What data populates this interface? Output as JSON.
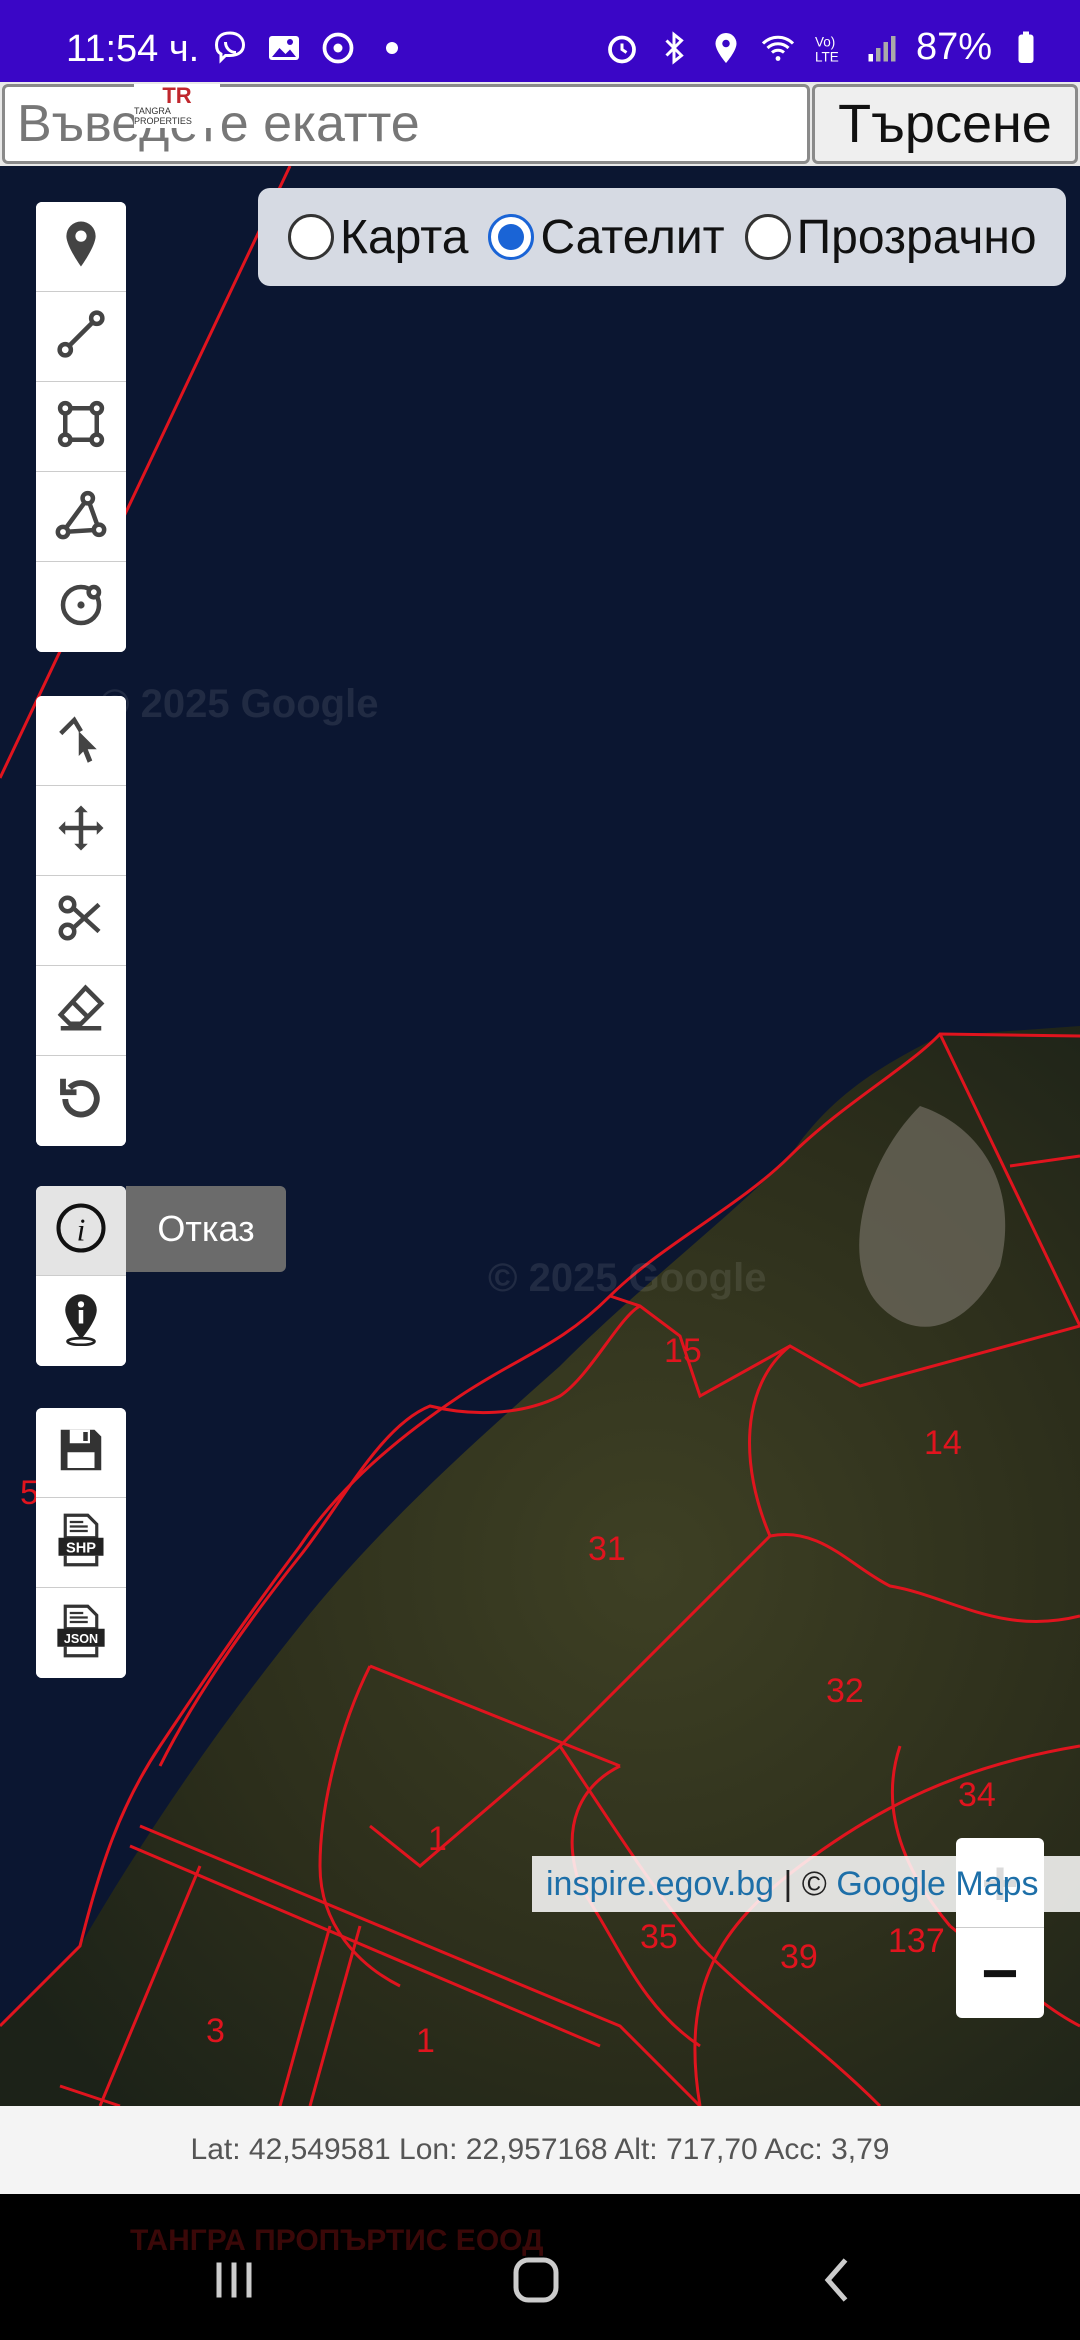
{
  "status_bar": {
    "time": "11:54 ч.",
    "battery": "87%",
    "colors": {
      "background": "#3a06c6"
    }
  },
  "search": {
    "placeholder": "Въведете екатте",
    "button_label": "Търсене"
  },
  "logo": {
    "mark": "TR",
    "text": "TANGRA PROPERTIES"
  },
  "layers": {
    "options": [
      {
        "label": "Карта",
        "checked": false
      },
      {
        "label": "Сателит",
        "checked": true
      },
      {
        "label": "Прозрачно",
        "checked": false
      }
    ]
  },
  "toolbar_draw": [
    "marker-icon",
    "polyline-icon",
    "rectangle-icon",
    "polygon-icon",
    "circle-icon"
  ],
  "toolbar_edit": [
    "select-icon",
    "move-icon",
    "cut-icon",
    "eraser-icon",
    "rotate-icon"
  ],
  "toolbar_info": [
    "info-icon",
    "location-info-icon"
  ],
  "toolbar_export": [
    "save-icon",
    "shp-file-icon",
    "json-file-icon"
  ],
  "tooltip": {
    "label": "Отказ"
  },
  "export_labels": {
    "shp": "SHP",
    "json": "JSON"
  },
  "map": {
    "watermark_1": "© 2025 Google",
    "watermark_2": "© 2025 Google",
    "parcel_labels": [
      {
        "label": "15"
      },
      {
        "label": "14"
      },
      {
        "label": "31"
      },
      {
        "label": "32"
      },
      {
        "label": "34"
      },
      {
        "label": "1"
      },
      {
        "label": "35"
      },
      {
        "label": "39"
      },
      {
        "label": "137"
      },
      {
        "label": "3"
      },
      {
        "label": "1"
      },
      {
        "label": "5"
      }
    ],
    "colors": {
      "parcel_line": "#e0141e",
      "parcel_label": "#e0141e",
      "water": "#0b1631"
    }
  },
  "zoom": {
    "in": "+",
    "out": "−"
  },
  "attribution": {
    "source": "inspire.egov.bg",
    "separator": " | © ",
    "provider": "Google Maps"
  },
  "coords": {
    "text": "Lat: 42,549581 Lon: 22,957168 Alt: 717,70 Acc: 3,79"
  },
  "footer": {
    "company": "ТАНГРА ПРОПЪРТИС ЕООД"
  }
}
